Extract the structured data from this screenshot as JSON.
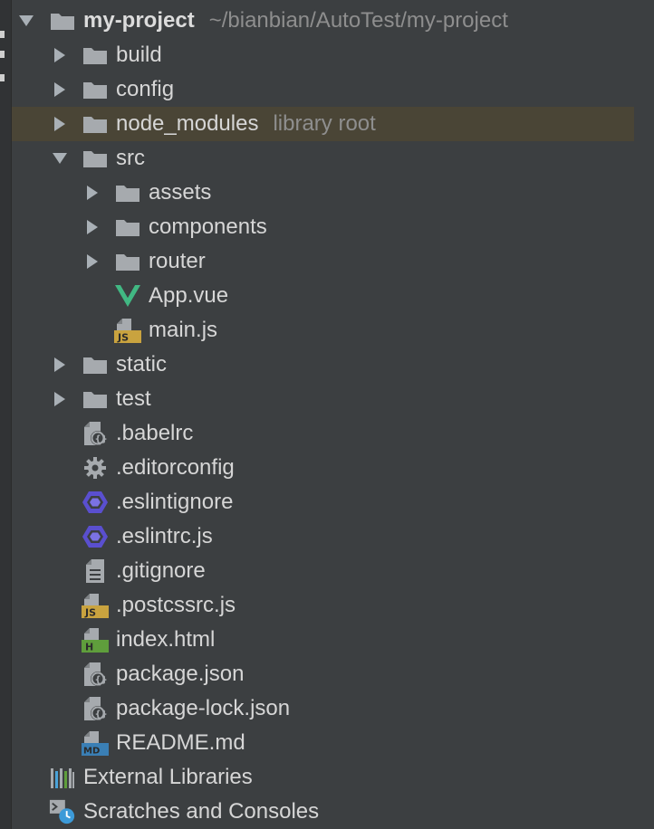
{
  "tree": {
    "root": {
      "name": "my-project",
      "path": "~/bianbian/AutoTest/my-project"
    },
    "build": "build",
    "config": "config",
    "node_modules": {
      "name": "node_modules",
      "hint": "library root"
    },
    "src": {
      "name": "src",
      "assets": "assets",
      "components": "components",
      "router": "router",
      "app_vue": "App.vue",
      "main_js": "main.js"
    },
    "static": "static",
    "test": "test",
    "files": {
      "babelrc": ".babelrc",
      "editorconfig": ".editorconfig",
      "eslintignore": ".eslintignore",
      "eslintrc": ".eslintrc.js",
      "gitignore": ".gitignore",
      "postcssrc": ".postcssrc.js",
      "index_html": "index.html",
      "package_json": "package.json",
      "package_lock": "package-lock.json",
      "readme": "README.md"
    },
    "external_libraries": "External Libraries",
    "scratches": "Scratches and Consoles"
  },
  "icons": {
    "badge_js": "JS",
    "badge_html": "H",
    "badge_md": "MD"
  },
  "colors": {
    "background": "#3c3f41",
    "text": "#d6d6d6",
    "hint": "#8e8e8e",
    "folder": "#a6aaae",
    "highlight_row": "#4a4536",
    "vue_green": "#41b883",
    "js_badge": "#c9a33f",
    "html_badge": "#5f9e3c",
    "md_badge": "#3a7fb5",
    "eslint_purple": "#5a4fcf",
    "clock_blue": "#3c9ad8"
  }
}
